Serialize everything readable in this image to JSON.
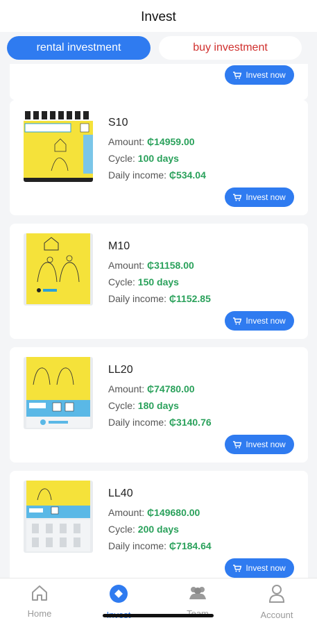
{
  "header": {
    "title": "Invest"
  },
  "tabs": [
    {
      "label": "rental investment",
      "active": true
    },
    {
      "label": "buy investment",
      "active": false
    }
  ],
  "invest_button_label": "Invest now",
  "field_labels": {
    "amount": "Amount:",
    "cycle": "Cycle:",
    "daily": "Daily income:"
  },
  "products": [
    {
      "name": "S10",
      "amount": "₵14959.00",
      "cycle": "100 days",
      "daily": "₵534.04"
    },
    {
      "name": "M10",
      "amount": "₵31158.00",
      "cycle": "150 days",
      "daily": "₵1152.85"
    },
    {
      "name": "LL20",
      "amount": "₵74780.00",
      "cycle": "180 days",
      "daily": "₵3140.76"
    },
    {
      "name": "LL40",
      "amount": "₵149680.00",
      "cycle": "200 days",
      "daily": "₵7184.64"
    }
  ],
  "nav": [
    {
      "label": "Home",
      "icon": "home-icon",
      "active": false
    },
    {
      "label": "Invest",
      "icon": "invest-icon",
      "active": true
    },
    {
      "label": "Team",
      "icon": "team-icon",
      "active": false
    },
    {
      "label": "Account",
      "icon": "account-icon",
      "active": false
    }
  ],
  "colors": {
    "accent": "#2f7bf0",
    "value_green": "#2aa15b",
    "buy_tab_text": "#d0302e",
    "poster_yellow": "#f5e23a"
  }
}
